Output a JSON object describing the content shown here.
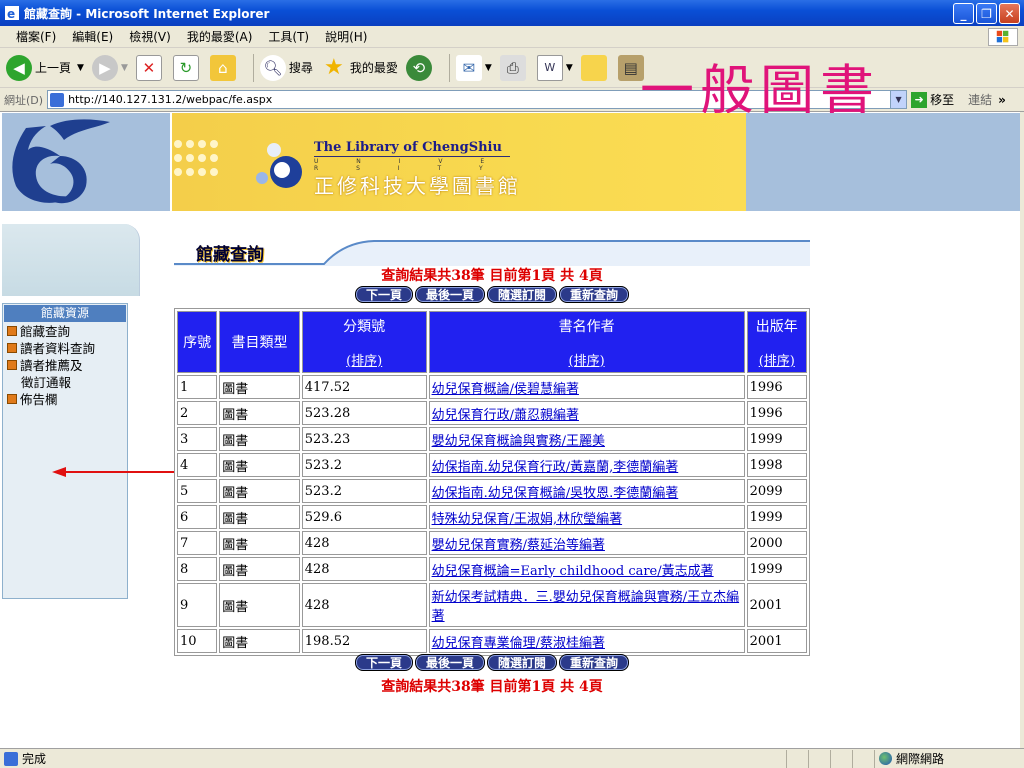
{
  "window": {
    "title": "館藏查詢 - Microsoft Internet Explorer"
  },
  "menu": [
    "檔案(F)",
    "編輯(E)",
    "檢視(V)",
    "我的最愛(A)",
    "工具(T)",
    "說明(H)"
  ],
  "toolbar": {
    "back": "上一頁",
    "search": "搜尋",
    "favorites": "我的最愛"
  },
  "address": {
    "label": "網址(D)",
    "url": "http://140.127.131.2/webpac/fe.aspx",
    "go": "移至",
    "links": "連結"
  },
  "overlay_title": "一般圖書",
  "banner": {
    "english": "The Library of ChengShiu",
    "university": "U N I V E R S I T Y",
    "chinese": "正修科技大學圖書館"
  },
  "sidebar": {
    "header": "館藏資源",
    "items": [
      {
        "label": "館藏查詢",
        "icon": true
      },
      {
        "label": "讀者資料查詢",
        "icon": true
      },
      {
        "label": "讀者推薦及",
        "icon": true
      },
      {
        "label": "徵訂通報",
        "icon": false
      },
      {
        "label": "佈告欄",
        "icon": true
      }
    ]
  },
  "section_title": "館藏查詢",
  "result_text": "查詢結果共38筆 目前第1頁 共 4頁",
  "buttons": [
    "下一頁",
    "最後一頁",
    "隨選訂閱",
    "重新查詢"
  ],
  "table": {
    "headers": {
      "seq": "序號",
      "type": "書目類型",
      "call": "分類號",
      "title": "書名作者",
      "year": "出版年",
      "sort": "(排序)"
    },
    "rows": [
      {
        "seq": "1",
        "type": "圖書",
        "call": "417.52",
        "title": "幼兒保育概論/侯碧慧編著",
        "year": "1996"
      },
      {
        "seq": "2",
        "type": "圖書",
        "call": "523.28",
        "title": "幼兒保育行政/蕭忍親編著",
        "year": "1996"
      },
      {
        "seq": "3",
        "type": "圖書",
        "call": "523.23",
        "title": "嬰幼兒保育概論與實務/王麗美",
        "year": "1999"
      },
      {
        "seq": "4",
        "type": "圖書",
        "call": "523.2",
        "title": "幼保指南.幼兒保育行政/黃嘉蘭,李德蘭編著",
        "year": "1998"
      },
      {
        "seq": "5",
        "type": "圖書",
        "call": "523.2",
        "title": "幼保指南.幼兒保育概論/吳牧恩.李德蘭編著",
        "year": "2099"
      },
      {
        "seq": "6",
        "type": "圖書",
        "call": "529.6",
        "title": "特殊幼兒保育/王淑娟,林欣瑩編著",
        "year": "1999"
      },
      {
        "seq": "7",
        "type": "圖書",
        "call": "428",
        "title": "嬰幼兒保育實務/蔡延治等編著",
        "year": "2000"
      },
      {
        "seq": "8",
        "type": "圖書",
        "call": "428",
        "title": "幼兒保育概論=Early childhood care/黃志成著",
        "year": "1999"
      },
      {
        "seq": "9",
        "type": "圖書",
        "call": "428",
        "title": "新幼保考試精典．三.嬰幼兒保育概論與實務/王立杰編著",
        "year": "2001"
      },
      {
        "seq": "10",
        "type": "圖書",
        "call": "198.52",
        "title": "幼兒保育專業倫理/蔡淑桂編著",
        "year": "2001"
      }
    ]
  },
  "status": {
    "text": "完成",
    "zone": "網際網路"
  },
  "colors": {
    "header_blue": "#2121f0",
    "result_red": "#dd0000",
    "overlay_pink": "#e0137a",
    "banner_yellow": "#f8d94f",
    "side_blue": "#a6bfdc"
  }
}
